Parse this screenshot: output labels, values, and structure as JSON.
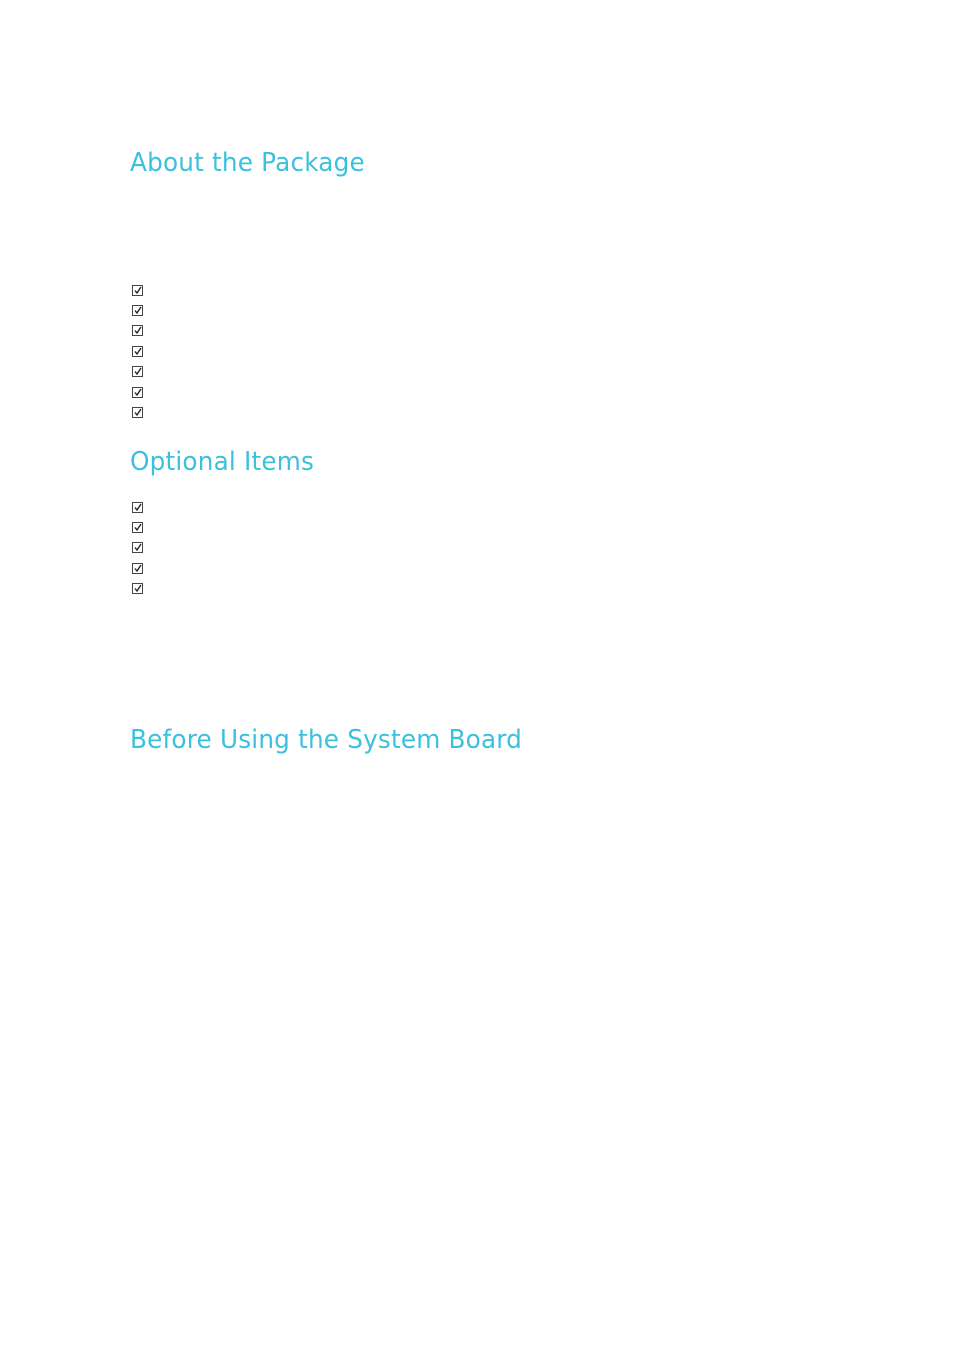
{
  "accent_color": "#3cc1dd",
  "sections": [
    {
      "heading": "About the Package",
      "checklist": [
        {
          "icon": "checked-box-icon",
          "label": ""
        },
        {
          "icon": "checked-box-icon",
          "label": ""
        },
        {
          "icon": "checked-box-icon",
          "label": ""
        },
        {
          "icon": "checked-box-icon",
          "label": ""
        },
        {
          "icon": "checked-box-icon",
          "label": ""
        },
        {
          "icon": "checked-box-icon",
          "label": ""
        },
        {
          "icon": "checked-box-icon",
          "label": ""
        }
      ]
    },
    {
      "heading": "Optional Items",
      "checklist": [
        {
          "icon": "checked-box-icon",
          "label": ""
        },
        {
          "icon": "checked-box-icon",
          "label": ""
        },
        {
          "icon": "checked-box-icon",
          "label": ""
        },
        {
          "icon": "checked-box-icon",
          "label": ""
        },
        {
          "icon": "checked-box-icon",
          "label": ""
        }
      ]
    },
    {
      "heading": "Before Using the System Board"
    }
  ]
}
